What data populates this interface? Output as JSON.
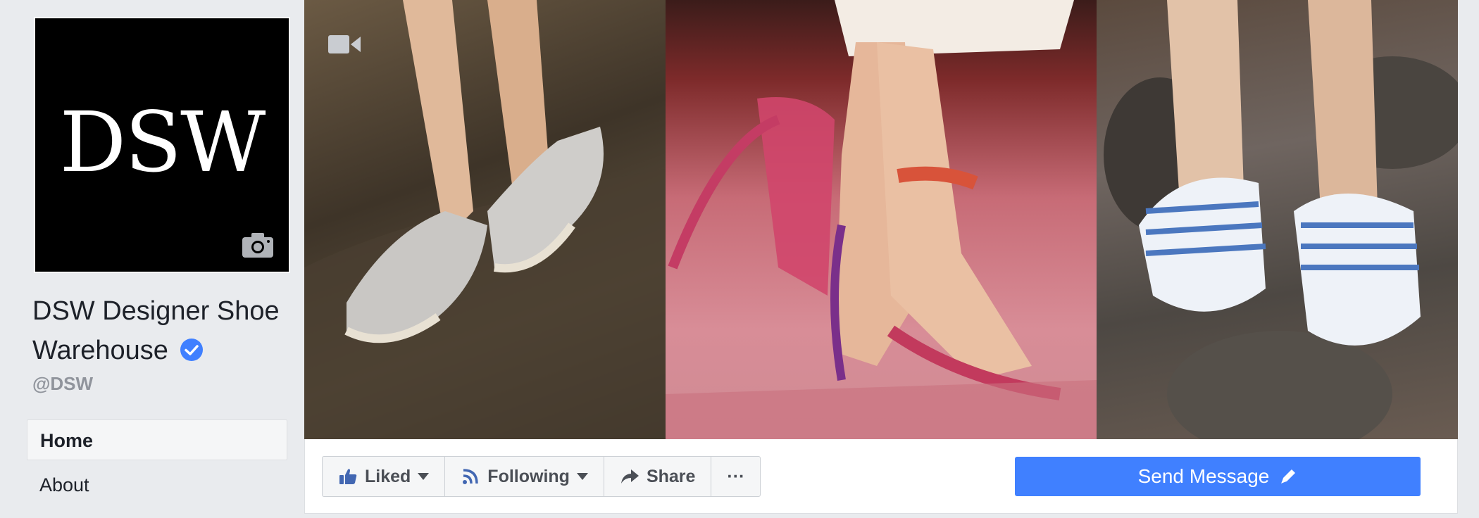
{
  "profile": {
    "logo_text": "DSW",
    "name": "DSW Designer Shoe Warehouse",
    "handle": "@DSW"
  },
  "nav": {
    "items": [
      {
        "label": "Home",
        "active": true
      },
      {
        "label": "About",
        "active": false
      }
    ]
  },
  "actions": {
    "liked_label": "Liked",
    "following_label": "Following",
    "share_label": "Share",
    "more_label": "···",
    "send_message_label": "Send Message"
  },
  "colors": {
    "primary_blue": "#4080ff",
    "verified": "#4080ff",
    "page_bg": "#e9ebee"
  },
  "icons": [
    "camera-icon",
    "verified-icon",
    "video-icon",
    "thumbs-up-icon",
    "rss-icon",
    "share-arrow-icon",
    "pencil-icon"
  ]
}
